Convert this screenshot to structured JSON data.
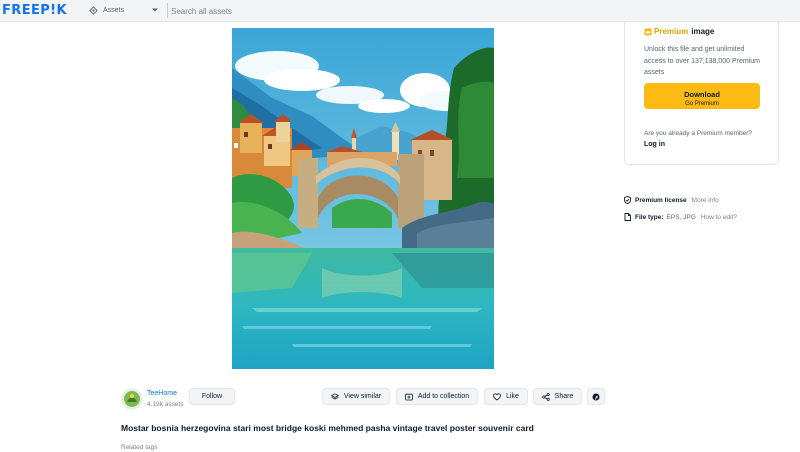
{
  "header": {
    "logo_text": "FREEP!K",
    "asset_type": "Assets",
    "search_placeholder": "Search all assets"
  },
  "premium_card": {
    "label_premium": "Premium",
    "label_rest": "image",
    "description": "Unlock this file and get unlimited access to over 137,138,000 Premium assets",
    "download_label": "Download",
    "download_sublabel": "Go Premium",
    "member_question": "Are you already a Premium member?",
    "login_label": "Log in"
  },
  "license": {
    "label": "Premium license",
    "more_info": "More info"
  },
  "file_type": {
    "label": "File type:",
    "value": "EPS, JPG",
    "how_to_edit": "How to edit?"
  },
  "author": {
    "name": "TeeHome",
    "asset_count": "4.19k assets",
    "follow_label": "Follow"
  },
  "actions": {
    "view_similar": "View similar",
    "add_to_collection": "Add to collection",
    "like": "Like",
    "share": "Share"
  },
  "asset": {
    "title": "Mostar bosnia herzegovina stari most bridge koski mehmed pasha vintage travel poster souvenir card",
    "related_tags_label": "Related tags"
  },
  "colors": {
    "brand_blue": "#1273eb",
    "premium_gold": "#fdba13",
    "text_dark": "#0e1b2c"
  }
}
